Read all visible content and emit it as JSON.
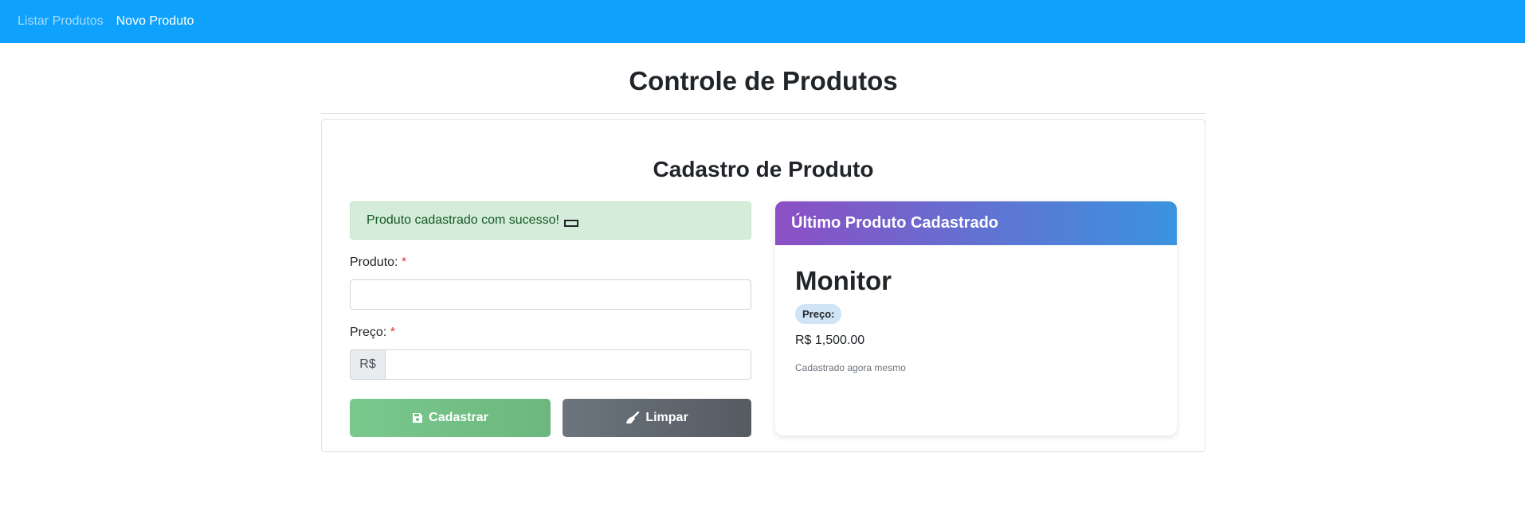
{
  "nav": {
    "list_label": "Listar Produtos",
    "new_label": "Novo Produto"
  },
  "page": {
    "title": "Controle de Produtos"
  },
  "form": {
    "title": "Cadastro de Produto",
    "alert_text": "Produto cadastrado com sucesso!",
    "product_label": "Produto:",
    "price_label": "Preço:",
    "required_mark": "*",
    "currency_prefix": "R$",
    "product_value": "",
    "price_value": "",
    "save_label": "Cadastrar",
    "clear_label": "Limpar",
    "save_icon": "floppy-disk-icon",
    "clear_icon": "broom-icon"
  },
  "last_product": {
    "header": "Último Produto Cadastrado",
    "name": "Monitor",
    "price_badge": "Preço:",
    "price": "R$ 1,500.00",
    "registered": "Cadastrado agora mesmo"
  },
  "colors": {
    "navbar": "#0ea2fd",
    "save_button": "#79c98d",
    "clear_button": "#6c757d",
    "header_gradient_start": "#8c4fc4",
    "header_gradient_end": "#3a93de",
    "alert_bg": "#d4edda",
    "required": "#dc3545"
  }
}
